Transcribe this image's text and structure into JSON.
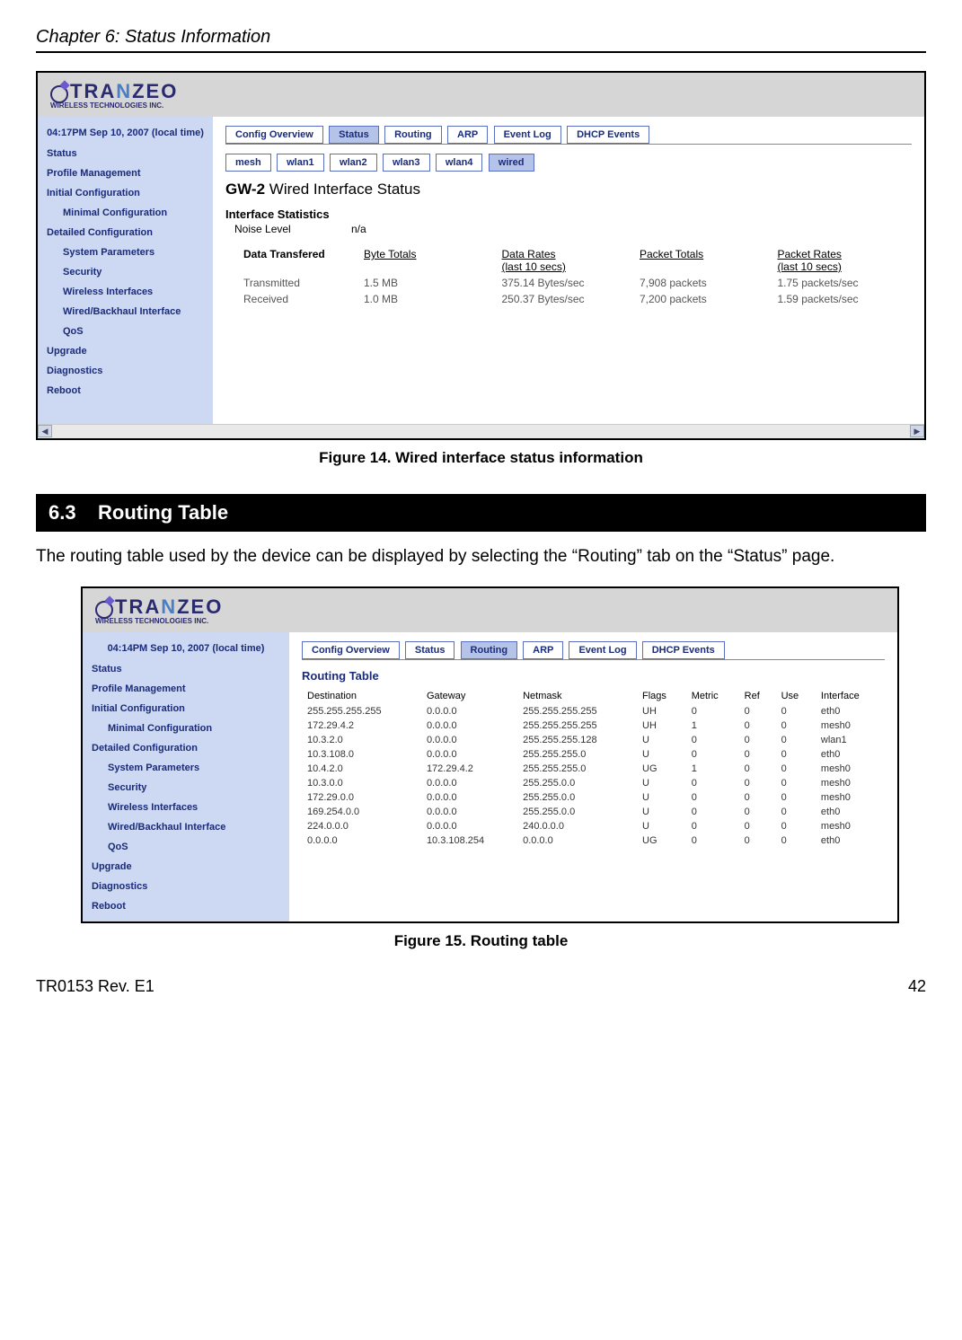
{
  "chapter_title": "Chapter 6: Status Information",
  "figure14": {
    "logo_main": "TRA",
    "logo_n": "N",
    "logo_end": "ZEO",
    "logo_sub": "WIRELESS  TECHNOLOGIES INC.",
    "timestamp": "04:17PM Sep 10, 2007 (local time)",
    "sidebar": [
      "Status",
      "Profile Management",
      "Initial Configuration",
      "Minimal Configuration",
      "Detailed Configuration",
      "System Parameters",
      "Security",
      "Wireless Interfaces",
      "Wired/Backhaul Interface",
      "QoS",
      "Upgrade",
      "Diagnostics",
      "Reboot"
    ],
    "tabs": [
      "Config Overview",
      "Status",
      "Routing",
      "ARP",
      "Event Log",
      "DHCP Events"
    ],
    "active_tab": "Status",
    "subtabs": [
      "mesh",
      "wlan1",
      "wlan2",
      "wlan3",
      "wlan4",
      "wired"
    ],
    "active_subtab": "wired",
    "heading_gw": "GW-2",
    "heading_text": "Wired Interface Status",
    "stats_header": "Interface Statistics",
    "noise_label": "Noise Level",
    "noise_value": "n/a",
    "data_transfered_label": "Data Transfered",
    "col_byte": "Byte Totals",
    "col_rates": "Data Rates",
    "col_rates_sub": "(last 10 secs)",
    "col_packets": "Packet Totals",
    "col_prates": "Packet Rates",
    "col_prates_sub": "(last 10 secs)",
    "tx_label": "Transmitted",
    "tx_bytes": "1.5 MB",
    "tx_rate": "375.14 Bytes/sec",
    "tx_pkts": "7,908 packets",
    "tx_prate": "1.75 packets/sec",
    "rx_label": "Received",
    "rx_bytes": "1.0 MB",
    "rx_rate": "250.37 Bytes/sec",
    "rx_pkts": "7,200 packets",
    "rx_prate": "1.59 packets/sec",
    "caption": "Figure 14. Wired interface status information"
  },
  "section": {
    "number": "6.3",
    "title": "Routing Table",
    "body": "The routing table used by the device can be displayed by selecting the “Routing” tab on the “Status” page."
  },
  "figure15": {
    "timestamp": "04:14PM Sep 10, 2007 (local time)",
    "sidebar": [
      "Status",
      "Profile Management",
      "Initial Configuration",
      "Minimal Configuration",
      "Detailed Configuration",
      "System Parameters",
      "Security",
      "Wireless Interfaces",
      "Wired/Backhaul Interface",
      "QoS",
      "Upgrade",
      "Diagnostics",
      "Reboot"
    ],
    "tabs": [
      "Config Overview",
      "Status",
      "Routing",
      "ARP",
      "Event Log",
      "DHCP Events"
    ],
    "active_tab": "Routing",
    "heading": "Routing Table",
    "cols": [
      "Destination",
      "Gateway",
      "Netmask",
      "Flags",
      "Metric",
      "Ref",
      "Use",
      "Interface"
    ],
    "rows": [
      [
        "255.255.255.255",
        "0.0.0.0",
        "255.255.255.255",
        "UH",
        "0",
        "0",
        "0",
        "eth0"
      ],
      [
        "172.29.4.2",
        "0.0.0.0",
        "255.255.255.255",
        "UH",
        "1",
        "0",
        "0",
        "mesh0"
      ],
      [
        "10.3.2.0",
        "0.0.0.0",
        "255.255.255.128",
        "U",
        "0",
        "0",
        "0",
        "wlan1"
      ],
      [
        "10.3.108.0",
        "0.0.0.0",
        "255.255.255.0",
        "U",
        "0",
        "0",
        "0",
        "eth0"
      ],
      [
        "10.4.2.0",
        "172.29.4.2",
        "255.255.255.0",
        "UG",
        "1",
        "0",
        "0",
        "mesh0"
      ],
      [
        "10.3.0.0",
        "0.0.0.0",
        "255.255.0.0",
        "U",
        "0",
        "0",
        "0",
        "mesh0"
      ],
      [
        "172.29.0.0",
        "0.0.0.0",
        "255.255.0.0",
        "U",
        "0",
        "0",
        "0",
        "mesh0"
      ],
      [
        "169.254.0.0",
        "0.0.0.0",
        "255.255.0.0",
        "U",
        "0",
        "0",
        "0",
        "eth0"
      ],
      [
        "224.0.0.0",
        "0.0.0.0",
        "240.0.0.0",
        "U",
        "0",
        "0",
        "0",
        "mesh0"
      ],
      [
        "0.0.0.0",
        "10.3.108.254",
        "0.0.0.0",
        "UG",
        "0",
        "0",
        "0",
        "eth0"
      ]
    ],
    "caption": "Figure 15. Routing table"
  },
  "footer": {
    "left": "TR0153 Rev. E1",
    "right": "42"
  }
}
